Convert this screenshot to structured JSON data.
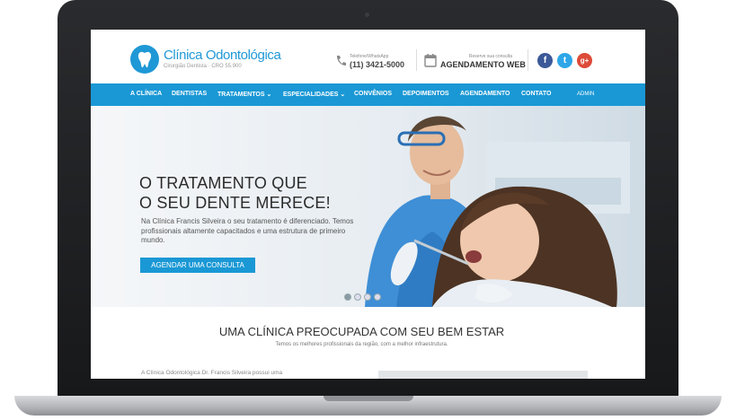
{
  "header": {
    "logo_title": "Clínica Odontológica",
    "logo_sub": "Cirurgião Dentista · CRO 55.900",
    "phone_caption": "Telefone/WhatsApp",
    "phone_number": "(11) 3421-5000",
    "schedule_caption": "Reserve sua consulta",
    "schedule_label": "AGENDAMENTO WEB",
    "social": {
      "facebook": "f",
      "twitter": "t",
      "google": "g+"
    }
  },
  "nav": {
    "items": [
      "A CLÍNICA",
      "DENTISTAS",
      "TRATAMENTOS ⌄",
      "ESPECIALIDADES ⌄",
      "CONVÊNIOS",
      "DEPOIMENTOS",
      "AGENDAMENTO",
      "CONTATO"
    ],
    "admin": "ADMIN"
  },
  "hero": {
    "title_line1": "O TRATAMENTO QUE",
    "title_line2": "O SEU DENTE MERECE!",
    "text": "Na Clínica Francis Silveira o seu tratamento é diferenciado. Temos profissionais altamente capacitados e uma estrutura de primeiro mundo.",
    "button": "AGENDAR UMA CONSULTA"
  },
  "section": {
    "title": "UMA CLÍNICA PREOCUPADA COM SEU BEM ESTAR",
    "subtitle": "Temos os melhores profissionais da região, com a melhor infraestrutura.",
    "teaser": "A Clínica Odontológica Dr. Francis Silveira possui uma"
  },
  "colors": {
    "brand": "#1a98d5",
    "facebook": "#3b5998",
    "twitter": "#2ea6e8",
    "google": "#dd4b39"
  }
}
